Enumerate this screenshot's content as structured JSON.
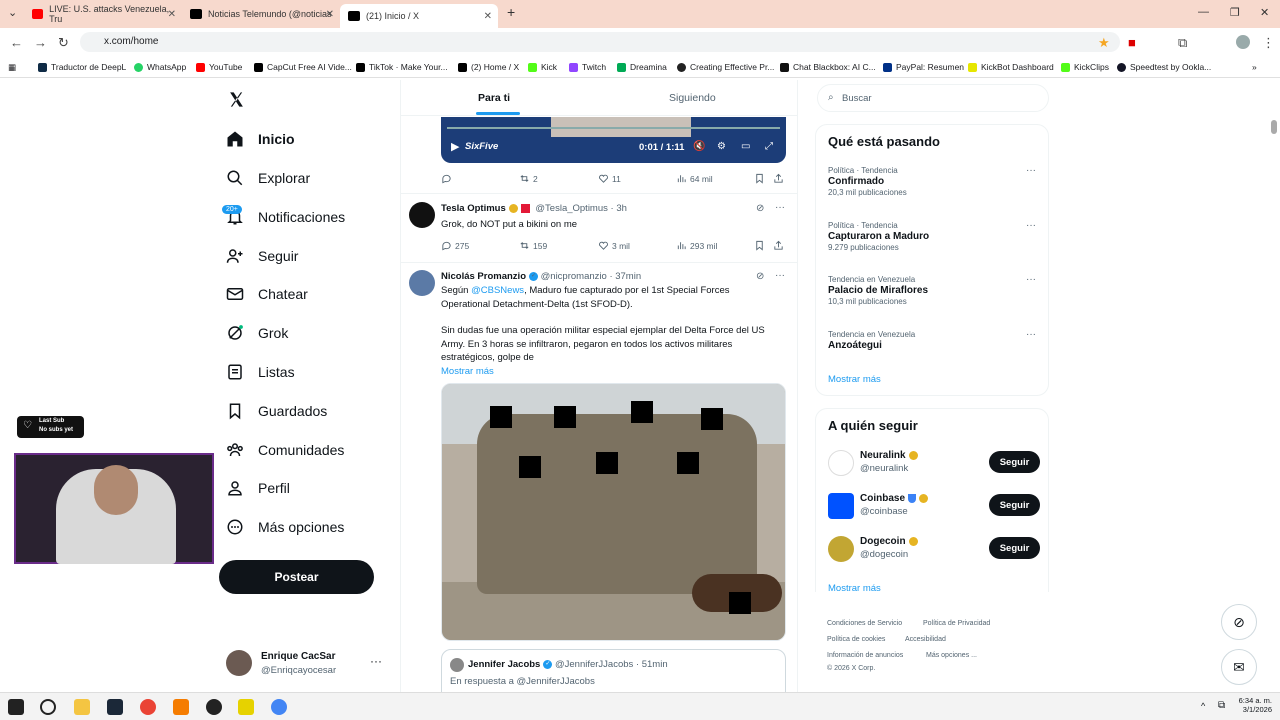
{
  "browser": {
    "tabs": [
      {
        "label": "LIVE: U.S. attacks Venezuela, Tru",
        "color": "#ff0000"
      },
      {
        "label": "Noticias Telemundo (@noticias",
        "color": "#000000"
      },
      {
        "label": "(21) Inicio / X",
        "color": "#000000"
      }
    ],
    "url": "x.com/home",
    "bookmarks": [
      "Traductor de DeepL",
      "WhatsApp",
      "YouTube",
      "CapCut Free AI Vide...",
      "TikTok · Make Your...",
      "(2) Home / X",
      "Kick",
      "Twitch",
      "Dreamina",
      "Creating Effective Pr...",
      "Chat Blackbox: AI C...",
      "PayPal: Resumen",
      "KickBot Dashboard",
      "KickClips",
      "Speedtest by Ookla..."
    ]
  },
  "nav": {
    "items": [
      "Inicio",
      "Explorar",
      "Notificaciones",
      "Seguir",
      "Chatear",
      "Grok",
      "Listas",
      "Guardados",
      "Comunidades",
      "Perfil",
      "Más opciones"
    ],
    "notif_badge": "20+",
    "post_button": "Postear",
    "account_name": "Enrique CacSar",
    "account_handle": "@Enriqcayocesar"
  },
  "feed": {
    "tabs": [
      "Para ti",
      "Siguiendo"
    ],
    "video": {
      "time": "0:01 / 1:11",
      "logo": "SixFive"
    },
    "post0_actions": {
      "retweets": "2",
      "likes": "11",
      "views": "64 mil"
    },
    "post1": {
      "name": "Tesla Optimus",
      "handle": "@Tesla_Optimus",
      "time": "· 3h",
      "text": "Grok, do NOT put a bikini on me",
      "replies": "275",
      "retweets": "159",
      "likes": "3 mil",
      "views": "293 mil"
    },
    "post2": {
      "name": "Nicolás Promanzio",
      "handle": "@nicpromanzio",
      "time": "· 37min",
      "line1_pre": "Según ",
      "mention": "@CBSNews",
      "line1_post": ", Maduro fue capturado por el 1st Special Forces Operational Detachment-Delta (1st SFOD-D).",
      "para2": "Sin dudas fue una operación militar especial ejemplar del Delta Force del US Army. En 3 horas se infiltraron, pegaron en todos los activos militares estratégicos, golpe de",
      "more": "Mostrar más"
    },
    "quoted": {
      "name": "Jennifer Jacobs",
      "handle": "@JenniferJJacobs",
      "time": "· 51min",
      "reply_to": "En respuesta a @JenniferJJacobs"
    }
  },
  "right": {
    "search_placeholder": "Buscar",
    "trends_title": "Qué está pasando",
    "trends": [
      {
        "ctx": "Política · Tendencia",
        "name": "Confirmado",
        "count": "20,3 mil publicaciones"
      },
      {
        "ctx": "Política · Tendencia",
        "name": "Capturaron a Maduro",
        "count": "9.279 publicaciones"
      },
      {
        "ctx": "Tendencia en Venezuela",
        "name": "Palacio de Miraflores",
        "count": "10,3 mil publicaciones"
      },
      {
        "ctx": "Tendencia en Venezuela",
        "name": "Anzoátegui",
        "count": ""
      }
    ],
    "show_more": "Mostrar más",
    "follow_title": "A quién seguir",
    "follow": [
      {
        "name": "Neuralink",
        "handle": "@neuralink",
        "btn": "Seguir"
      },
      {
        "name": "Coinbase",
        "handle": "@coinbase",
        "btn": "Seguir"
      },
      {
        "name": "Dogecoin",
        "handle": "@dogecoin",
        "btn": "Seguir"
      }
    ],
    "footer": [
      "Condiciones de Servicio",
      "Política de Privacidad",
      "Política de cookies",
      "Accesibilidad",
      "Información de anuncios",
      "Más opciones ...",
      "© 2026 X Corp."
    ]
  },
  "overlay": {
    "sub_title": "Last Sub",
    "sub_value": "No subs yet"
  },
  "taskbar": {
    "time": "6:34 a. m.",
    "date": "3/1/2026"
  }
}
